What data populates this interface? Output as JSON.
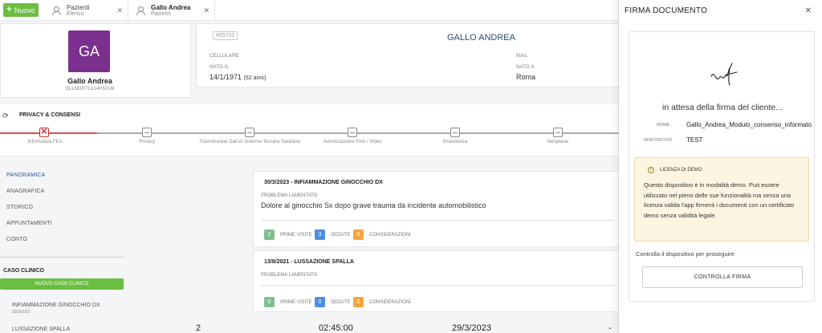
{
  "topbar": {
    "new_label": "Nuovo",
    "tabs": [
      {
        "title": "Pazienti",
        "subtitle": "Elenco"
      },
      {
        "title": "Gallo Andrea",
        "subtitle": "Pazienti"
      }
    ]
  },
  "patient": {
    "initials": "GA",
    "name": "Gallo Andrea",
    "fiscal_code": "GLLNDR71A14H501M",
    "id": "#55702",
    "title": "GALLO ANDREA",
    "cellulare_label": "CELLULARE",
    "mail_label": "MAIL",
    "nato_il_label": "NATO IL",
    "nato_il": "14/1/1971",
    "age": "(52 anni)",
    "nato_a_label": "NATO A",
    "nato_a": "Roma"
  },
  "privacy": {
    "title": "PRIVACY & CONSENSI",
    "steps": [
      "Informativa FEA",
      "Privacy",
      "Trasmissione Dati Al Sistema Tessera Sanitaria",
      "Autorizzazione Foto / Video",
      "Gravidanza",
      "Neoplasie"
    ]
  },
  "nav": {
    "items": [
      "PANORAMICA",
      "ANAGRAFICA",
      "STORICO",
      "APPUNTAMENTI",
      "CONTO"
    ],
    "caso_title": "CASO CLINICO",
    "new_caso": "NUOVO CASO CLINICO",
    "casi": [
      {
        "name": "INFIAMMAZIONE GINOCCHIO DX",
        "date": "30/3/2023"
      },
      {
        "name": "LUSSAZIONE SPALLA",
        "date": ""
      }
    ]
  },
  "visits": [
    {
      "title": "30/3/2023 - INFIAMMAZIONE GINOCCHIO DX",
      "problem_label": "PROBLEMA LAMENTATO",
      "problem": "Dolore al ginocchio Sx dopo grave trauma da incidente automobilistico",
      "prime": "2",
      "sedute": "3",
      "considerazioni": "0"
    },
    {
      "title": "13/8/2021 - LUSSAZIONE SPALLA",
      "problem_label": "PROBLEMA LAMENTATO",
      "problem": "",
      "prime": "0",
      "sedute": "0",
      "considerazioni": "0"
    }
  ],
  "badge_labels": {
    "prime": "PRIME VISITE",
    "sedute": "SEDUTE",
    "considerazioni": "CONSIDERAZIONI"
  },
  "bottom_row": [
    "2",
    "02:45:00",
    "29/3/2023",
    "-"
  ],
  "drawer": {
    "title": "FIRMA DOCUMENTO",
    "waiting": "in attesa della firma del cliente...",
    "nome_label": "NOME",
    "nome": "Gallo_Andrea_Modulo_consenso_informato",
    "dispositivo_label": "DISPOSITIVO",
    "dispositivo": "TEST",
    "license_title": "LICENZA DI DEMO",
    "license_text": "Questo dispositivo è in modalità demo. Può essere utilizzato nel pieno delle sue funzionalità ma senza una licenza valida l'app firmerà i documenti con un certificato demo senza validità legale.",
    "control_text": "Controlla il dispositivo per proseguire",
    "control_button": "CONTROLLA FIRMA"
  },
  "colors": {
    "accent_green": "#6abf40",
    "avatar": "#7b2f8f",
    "badge_green": "#7fbf8f",
    "badge_blue": "#4a8fe0",
    "badge_orange": "#f0a640",
    "error_red": "#c9302c"
  }
}
